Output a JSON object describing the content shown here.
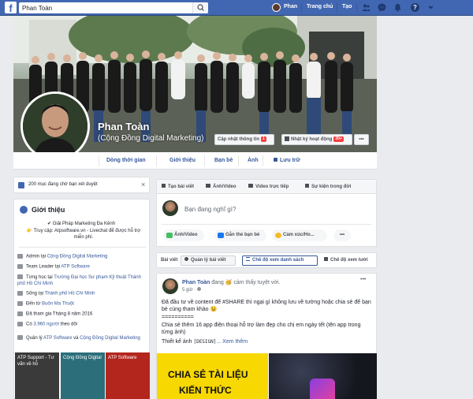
{
  "topbar": {
    "logo": "f",
    "search_value": "Phan Toàn",
    "user_name": "Phan",
    "home_label": "Trang chủ",
    "create_label": "Tạo",
    "icons": [
      "friends-icon",
      "messenger-icon",
      "notifications-icon",
      "help-icon",
      "dropdown-icon"
    ],
    "help_glyph": "?"
  },
  "cover": {
    "name": "Phan Toàn",
    "subtitle": "(Cộng Đồng Digital Marketing)",
    "update_info_label": "Cập nhật thông tin",
    "update_info_badge": "1",
    "activity_log_label": "Nhật ký hoạt động",
    "activity_log_badge": "20+",
    "more_label": "•••"
  },
  "tabs": [
    "Dòng thời gian",
    "Giới thiệu",
    "Bạn bè",
    "Ảnh",
    "Lưu trữ"
  ],
  "pending": {
    "text": "200 mục đang chờ bạn xét duyệt",
    "close": "×"
  },
  "intro": {
    "title": "Giới thiệu",
    "bio_line1": "✔ Giải Pháp Marketing Đa Kênh",
    "bio_line2": "👉 Truy cập: Atpsoftware.vn - Livechat để được hỗ trợ miễn phí.",
    "rows": [
      {
        "pre": "Admin tại ",
        "link": "Cộng Đồng Digital Marketing"
      },
      {
        "pre": "Team Leader tại ",
        "link": "ATP Software"
      },
      {
        "pre": "Từng học tại ",
        "link": "Trường Đại học Sư phạm Kỹ thuật Thành phố Hồ Chí Minh"
      },
      {
        "pre": "Sống tại ",
        "link": "Thành phố Hồ Chí Minh"
      },
      {
        "pre": "Đến từ ",
        "link": "Buôn Ma Thuột"
      },
      {
        "pre": "Đã tham gia Tháng 8 năm 2016",
        "link": ""
      },
      {
        "pre": "Có ",
        "link": "3.960 người",
        "post": " theo dõi"
      }
    ],
    "manage_pre": "Quản lý ",
    "manage_link1": "ATP Software",
    "manage_and": " và ",
    "manage_link2": "Cộng Đồng Digital Marketing"
  },
  "thumbs": [
    {
      "title": "ATP Support - Tư vấn về hỗ",
      "color": "#3a3a3a"
    },
    {
      "title": "Cộng Đồng Digital",
      "color": "#2c6e7a"
    },
    {
      "title": "ATP Software",
      "color": "#b3261e"
    },
    {
      "title": "",
      "color": "#252a30"
    }
  ],
  "composer": {
    "tabs": [
      "Tạo bài viết",
      "Ảnh/Video",
      "Video trực tiếp",
      "Sự kiện trong đời"
    ],
    "placeholder": "Bạn đang nghĩ gì?",
    "actions": [
      "Ảnh/Video",
      "Gắn thẻ bạn bè",
      "Cảm xúc/Ho..."
    ],
    "more": "•••"
  },
  "posts_bar": {
    "label": "Bài viết",
    "manage": "Quản lý bài viết",
    "list_view": "Chế độ xem danh sách",
    "grid_view": "Chế độ xem lưới"
  },
  "post": {
    "author": "Phan Toàn",
    "feeling": " đang 🥳 cảm thấy tuyệt vời.",
    "time": "5 giờ · ",
    "more": "•••",
    "body1": "Đã đầu tư về content để #SHARE thì ngại gì không lưu về tường hoặc chia sẻ để bạn bè cùng tham khảo 😉",
    "hashtag": "#SHARE",
    "body2": "==========",
    "body3": "Chia sẻ thêm 16 app điện thoại hỗ trợ làm đẹp cho chị em ngày tết (tên app trong từng ảnh)",
    "body4_pre": "Thiết kế ảnh ",
    "body4_tag": "[DESIGN]",
    "body4_more": "... Xem thêm",
    "banner_line1": "CHIA SẺ TÀI LIỆU",
    "banner_line2": "KIẾN THỨC"
  },
  "colors": {
    "brand": "#4267b2",
    "link": "#365899",
    "badge": "#fa3e3e",
    "banner_yellow": "#f7d800"
  }
}
